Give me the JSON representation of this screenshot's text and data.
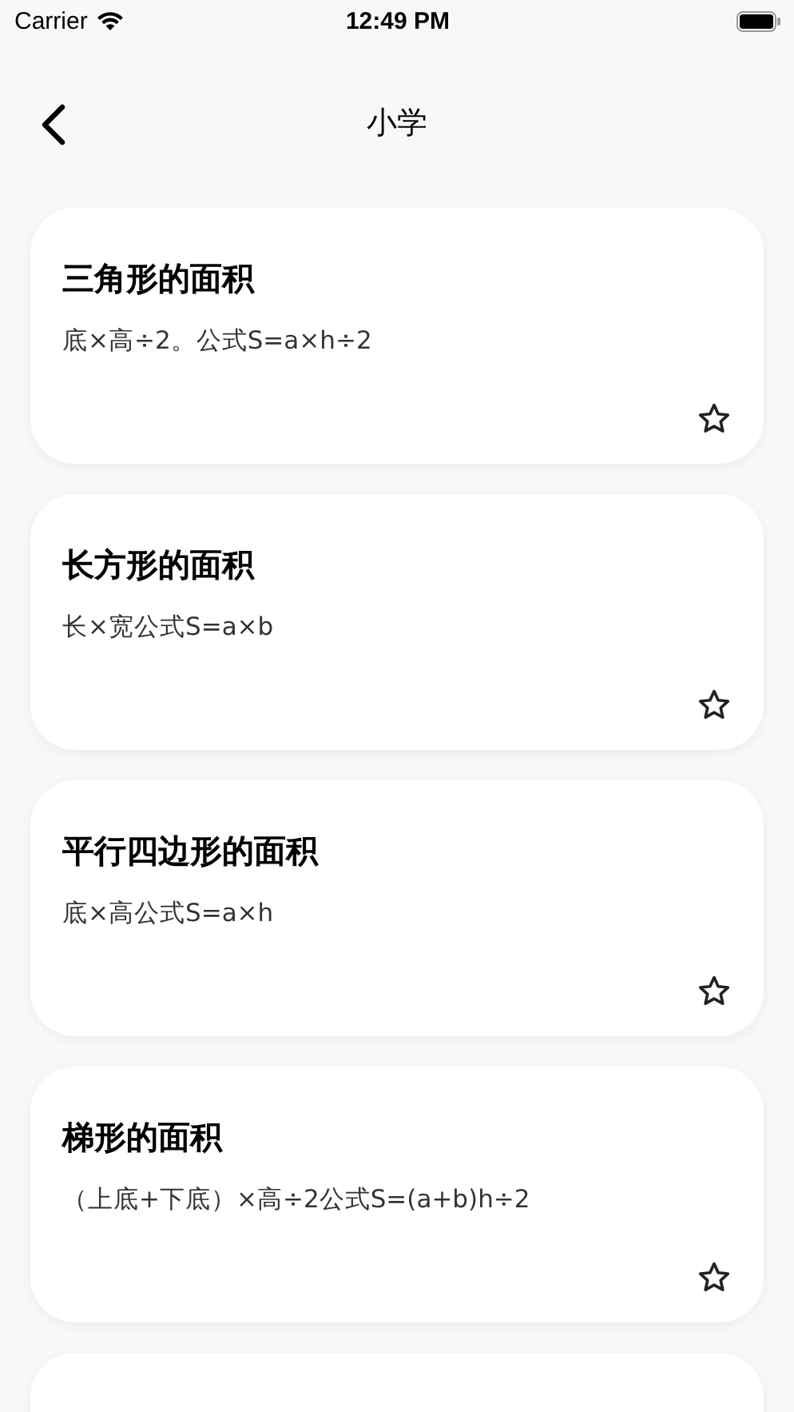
{
  "status_bar": {
    "carrier": "Carrier",
    "time": "12:49 PM"
  },
  "nav": {
    "title": "小学"
  },
  "cards": [
    {
      "title": "三角形的面积",
      "formula": "底×高÷2。公式S=a×h÷2",
      "favorited": false
    },
    {
      "title": "长方形的面积",
      "formula": "长×宽公式S=a×b",
      "favorited": false
    },
    {
      "title": "平行四边形的面积",
      "formula": "底×高公式S=a×h",
      "favorited": false
    },
    {
      "title": "梯形的面积",
      "formula": "（上底+下底）×高÷2公式S=(a+b)h÷2",
      "favorited": false
    }
  ]
}
